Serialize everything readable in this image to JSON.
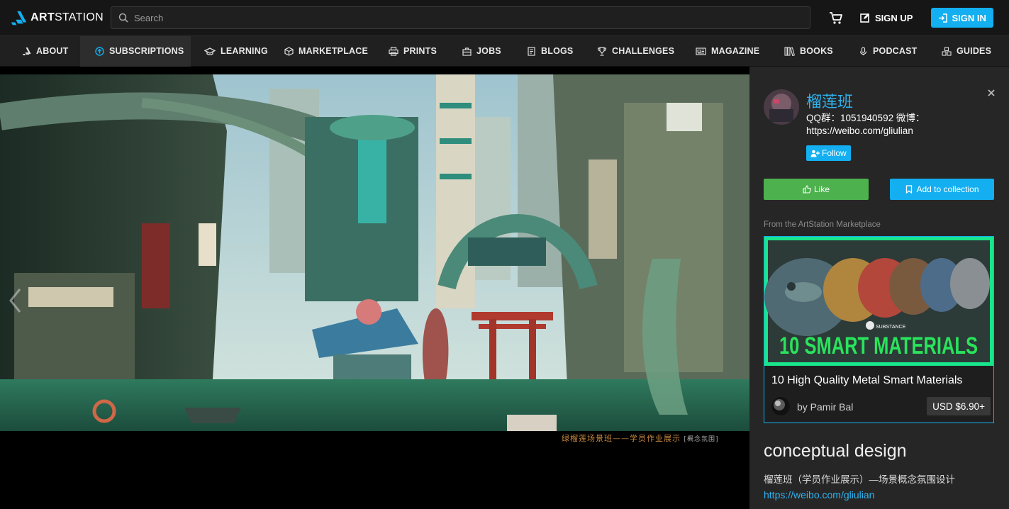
{
  "header": {
    "brand_bold": "ART",
    "brand_light": "STATION",
    "search_placeholder": "Search",
    "signup_label": "SIGN UP",
    "signin_label": "SIGN IN",
    "icons": [
      "artstation-logo-icon",
      "search-icon",
      "cart-icon",
      "pencil-square-icon",
      "sign-in-icon"
    ]
  },
  "nav": {
    "items": [
      {
        "label": "ABOUT",
        "icon": "artstation-small-icon"
      },
      {
        "label": "SUBSCRIPTIONS",
        "icon": "circle-arrow-up-icon",
        "active": true
      },
      {
        "label": "LEARNING",
        "icon": "graduation-cap-icon"
      },
      {
        "label": "MARKETPLACE",
        "icon": "cube-icon"
      },
      {
        "label": "PRINTS",
        "icon": "printer-icon"
      },
      {
        "label": "JOBS",
        "icon": "briefcase-icon"
      },
      {
        "label": "BLOGS",
        "icon": "document-icon"
      },
      {
        "label": "CHALLENGES",
        "icon": "trophy-icon"
      },
      {
        "label": "MAGAZINE",
        "icon": "newspaper-icon"
      },
      {
        "label": "BOOKS",
        "icon": "books-icon"
      },
      {
        "label": "PODCAST",
        "icon": "microphone-icon"
      },
      {
        "label": "GUIDES",
        "icon": "boxes-icon"
      }
    ]
  },
  "viewer": {
    "caption_main": "绿榴莲场景班——学员作业展示",
    "caption_tag": "[概念氛围]"
  },
  "sidebar": {
    "artist_name": "榴莲班",
    "artist_bio": "QQ群：1051940592 微博：https://weibo.com/gliulian",
    "follow_label": "Follow",
    "like_label": "Like",
    "collection_label": "Add to collection",
    "marketplace_label": "From the ArtStation Marketplace",
    "product": {
      "banner_brand": "SUBSTANCE",
      "banner_text": "10 SMART MATERIALS",
      "title": "10 High Quality Metal Smart Materials",
      "seller": "by Pamir Bal",
      "price": "USD $6.90+"
    },
    "art_title": "conceptual design",
    "art_description": "榴莲班（学员作业展示）—场景概念氛围设计",
    "art_link": "https://weibo.com/gliulian"
  },
  "colors": {
    "accent": "#13aff0",
    "like_green": "#4db14e",
    "topbar": "#161616",
    "navbar": "#202020",
    "sidebar": "#262626",
    "banner_green": "#19e58c"
  }
}
